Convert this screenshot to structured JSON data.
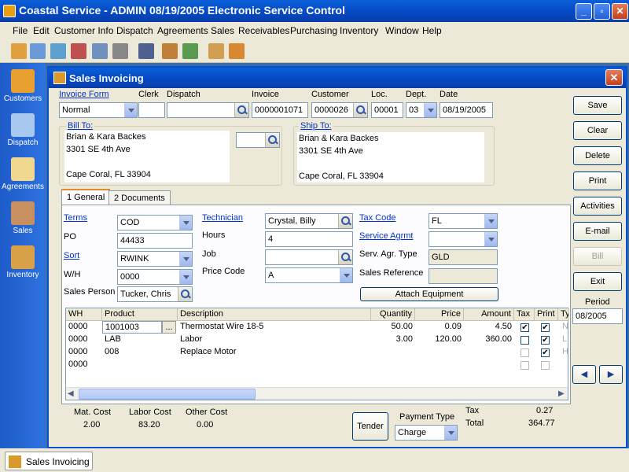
{
  "app": {
    "title": "Coastal Service - ADMIN 08/19/2005 Electronic Service Control",
    "minimize": "_",
    "restore": "▫",
    "close": "✕"
  },
  "menu": [
    "File",
    "Edit",
    "Customer Info",
    "Dispatch",
    "Agreements",
    "Sales",
    "Receivables",
    "Purchasing",
    "Inventory",
    "Window",
    "Help"
  ],
  "sidebar": [
    {
      "label": "Customers",
      "icon": "customers-icon",
      "color": "#e8a030"
    },
    {
      "label": "Dispatch",
      "icon": "dispatch-icon",
      "color": "#a8c8f0"
    },
    {
      "label": "Agreements",
      "icon": "agreements-icon",
      "color": "#f0d890"
    },
    {
      "label": "Sales",
      "icon": "sales-icon",
      "color": "#c89060"
    },
    {
      "label": "Inventory",
      "icon": "inventory-icon",
      "color": "#d8a048"
    }
  ],
  "window": {
    "title": "Sales Invoicing",
    "close": "✕"
  },
  "header": {
    "invoice_form_label": "Invoice Form",
    "invoice_form": "Normal",
    "clerk_label": "Clerk",
    "clerk": "",
    "dispatch_label": "Dispatch",
    "dispatch": "",
    "invoice_label": "Invoice",
    "invoice": "0000001071",
    "customer_label": "Customer",
    "customer": "0000026",
    "loc_label": "Loc.",
    "loc": "00001",
    "dept_label": "Dept.",
    "dept": "03",
    "date_label": "Date",
    "date": "08/19/2005"
  },
  "bill_to": {
    "label": "Bill To:",
    "line1": "Brian & Kara Backes",
    "line2": "3301 SE 4th Ave",
    "line3": "",
    "line4": "Cape Coral, FL  33904"
  },
  "ship_to": {
    "label": "Ship To:",
    "line1": "Brian & Kara Backes",
    "line2": "3301 SE 4th Ave",
    "line3": "",
    "line4": "Cape Coral, FL  33904"
  },
  "tabs": [
    "1 General",
    "2 Documents"
  ],
  "general": {
    "terms_label": "Terms",
    "terms": "COD",
    "po_label": "PO",
    "po": "44433",
    "sort_label": "Sort",
    "sort": "RWINK",
    "wh_label": "W/H",
    "wh": "0000",
    "sales_person_label": "Sales Person",
    "sales_person": "Tucker, Chris",
    "technician_label": "Technician",
    "technician": "Crystal, Billy",
    "hours_label": "Hours",
    "hours": "4",
    "job_label": "Job",
    "job": "",
    "price_code_label": "Price Code",
    "price_code": "A",
    "tax_code_label": "Tax Code",
    "tax_code": "FL",
    "service_agrmt_label": "Service Agrmt",
    "service_agrmt": "",
    "serv_agr_type_label": "Serv. Agr. Type",
    "serv_agr_type": "GLD",
    "sales_reference_label": "Sales Reference",
    "sales_reference": "",
    "attach_equipment": "Attach Equipment"
  },
  "grid": {
    "columns": [
      "WH",
      "Product",
      "Description",
      "Quantity",
      "Price",
      "Amount",
      "Tax",
      "Print",
      "Ty"
    ],
    "rows": [
      {
        "wh": "0000",
        "product": "1001003",
        "description": "Thermostat Wire 18-5",
        "quantity": "50.00",
        "price": "0.09",
        "amount": "4.50",
        "tax": true,
        "print": true,
        "type": "N"
      },
      {
        "wh": "0000",
        "product": "LAB",
        "description": "Labor",
        "quantity": "3.00",
        "price": "120.00",
        "amount": "360.00",
        "tax": false,
        "print": true,
        "type": "L"
      },
      {
        "wh": "0000",
        "product": "008",
        "description": "Replace Motor",
        "quantity": "",
        "price": "",
        "amount": "",
        "tax": false,
        "print": true,
        "type": "H"
      },
      {
        "wh": "0000",
        "product": "",
        "description": "",
        "quantity": "",
        "price": "",
        "amount": "",
        "tax": false,
        "print": false,
        "type": ""
      }
    ],
    "ellipsis": "..."
  },
  "footer": {
    "mat_cost_label": "Mat. Cost",
    "mat_cost": "2.00",
    "labor_cost_label": "Labor Cost",
    "labor_cost": "83.20",
    "other_cost_label": "Other Cost",
    "other_cost": "0.00",
    "tender": "Tender",
    "payment_type_label": "Payment Type",
    "payment_type": "Charge",
    "tax_label": "Tax",
    "tax": "0.27",
    "total_label": "Total",
    "total": "364.77"
  },
  "actions": [
    "Save",
    "Clear",
    "Delete",
    "Print",
    "Activities",
    "E-mail",
    "Bill",
    "Exit"
  ],
  "period": {
    "label": "Period",
    "value": "08/2005"
  },
  "nav": {
    "prev": "◀",
    "next": "▶"
  },
  "taskbar": {
    "item": "Sales Invoicing"
  }
}
